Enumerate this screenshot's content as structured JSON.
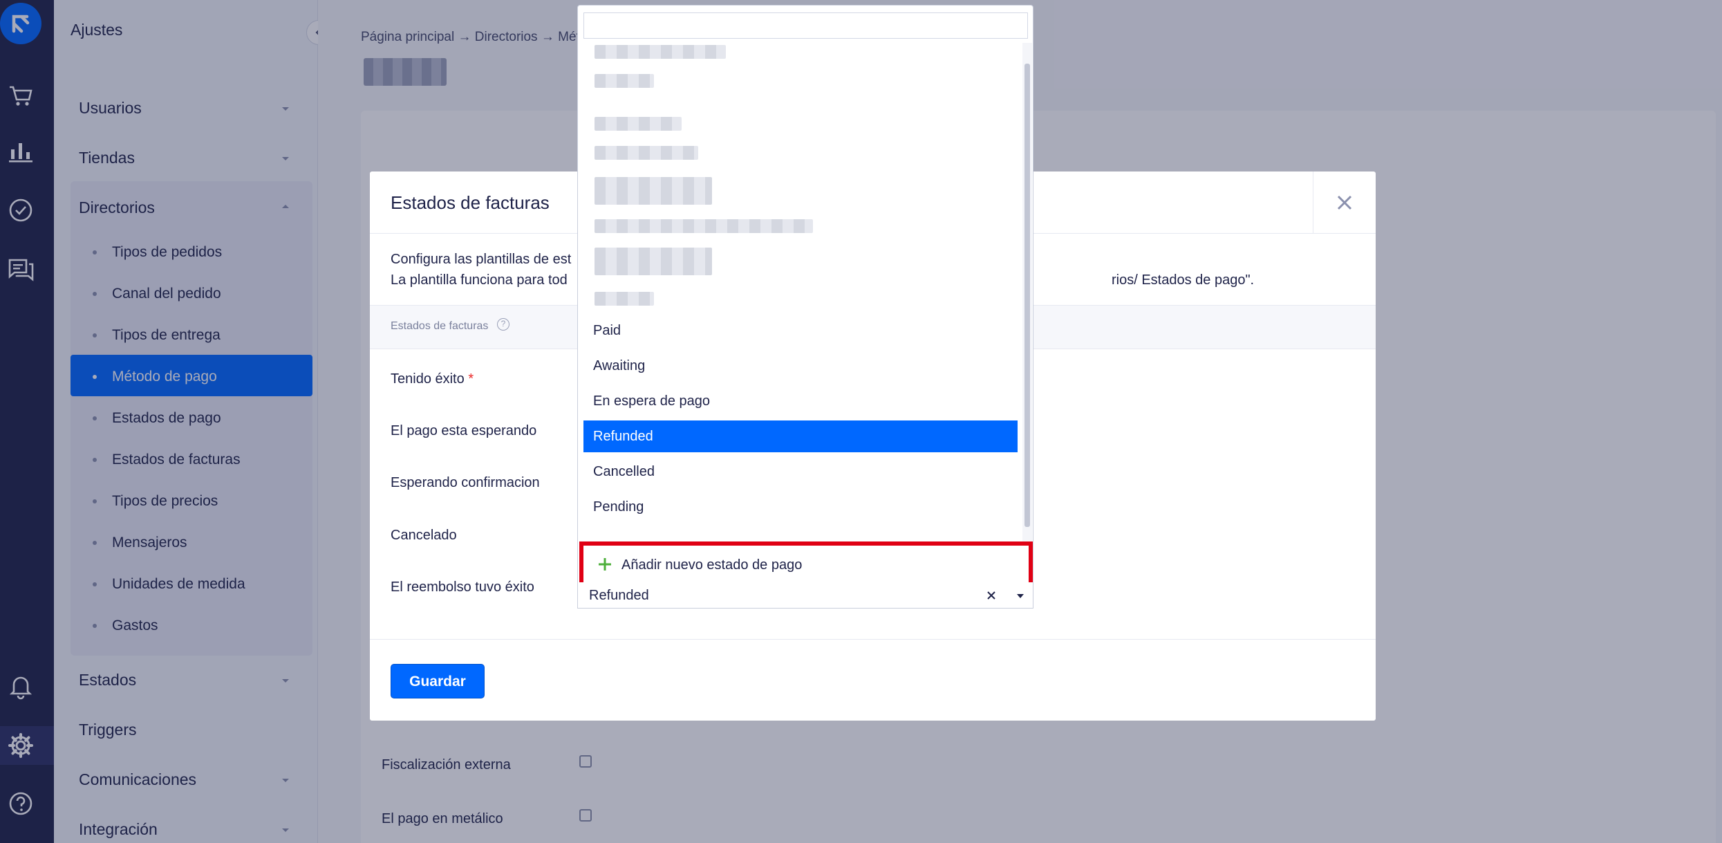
{
  "rail": {
    "icons": [
      "logo-icon",
      "cart-icon",
      "analytics-icon",
      "tasks-check-icon",
      "chat-icon",
      "bell-icon",
      "settings-gear-icon",
      "help-icon"
    ]
  },
  "sidebar": {
    "title": "Ajustes",
    "sections": [
      {
        "label": "Usuarios"
      },
      {
        "label": "Tiendas"
      },
      {
        "label": "Directorios"
      }
    ],
    "subitems": [
      {
        "label": "Tipos de pedidos"
      },
      {
        "label": "Canal del pedido"
      },
      {
        "label": "Tipos de entrega"
      },
      {
        "label": "Método de pago"
      },
      {
        "label": "Estados de pago"
      },
      {
        "label": "Estados de facturas"
      },
      {
        "label": "Tipos de precios"
      },
      {
        "label": "Mensajeros"
      },
      {
        "label": "Unidades de medida"
      },
      {
        "label": "Gastos"
      }
    ],
    "bottom_sections": [
      {
        "label": "Estados"
      },
      {
        "label": "Triggers"
      },
      {
        "label": "Comunicaciones"
      },
      {
        "label": "Integración"
      }
    ],
    "active_subitem": "Método de pago"
  },
  "page": {
    "breadcrumb": "Página principal → Directorios → Métod",
    "bg_fields": [
      {
        "label": "Fiscalización externa"
      },
      {
        "label": "El pago en metálico"
      }
    ]
  },
  "modal": {
    "title": "Estados de facturas",
    "description_line1": "Configura las plantillas de est",
    "description_line2": "La plantilla funciona para tod",
    "description_line2_end": "rios/ Estados de pago\".",
    "band_label": "Estados de facturas",
    "help_glyph": "?",
    "fields": [
      {
        "label": "Tenido éxito",
        "required": "*"
      },
      {
        "label": "El pago esta esperando"
      },
      {
        "label": "Esperando confirmacion"
      },
      {
        "label": "Cancelado"
      },
      {
        "label": "El reembolso tuvo éxito"
      }
    ],
    "save_label": "Guardar",
    "select_value": "Refunded"
  },
  "dropdown": {
    "search_placeholder": "",
    "options": [
      {
        "label": "Paid"
      },
      {
        "label": "Awaiting"
      },
      {
        "label": "En espera de pago"
      },
      {
        "label": "Refunded"
      },
      {
        "label": "Cancelled"
      },
      {
        "label": "Pending"
      }
    ],
    "selected": "Refunded",
    "add_label": "Añadir nuevo estado de pago"
  },
  "colors": {
    "accent": "#0068ff",
    "highlight_border": "#e00014",
    "add_plus": "#4caf3a",
    "required": "#ea2a2a",
    "rail_bg": "#1e2248"
  }
}
